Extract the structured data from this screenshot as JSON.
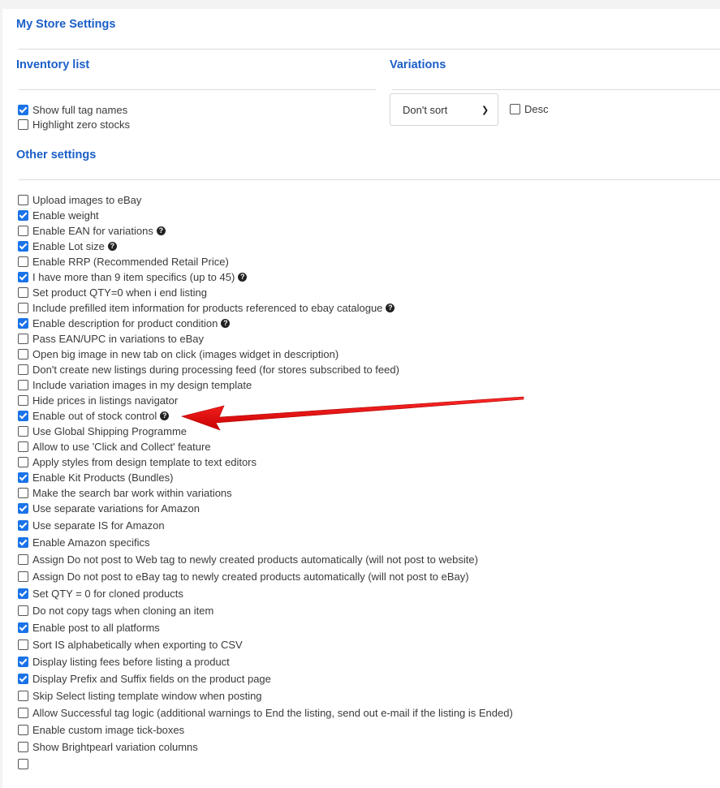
{
  "page_title": "My Store Settings",
  "inventory_list": {
    "title": "Inventory list",
    "options": [
      {
        "label": "Show full tag names",
        "checked": true
      },
      {
        "label": "Highlight zero stocks",
        "checked": false
      }
    ]
  },
  "variations": {
    "title": "Variations",
    "sort_select": {
      "value": "Don't sort"
    },
    "desc": {
      "label": "Desc",
      "checked": false
    }
  },
  "other_settings": {
    "title": "Other settings",
    "options": [
      {
        "label": "Upload images to eBay",
        "checked": false,
        "help": false
      },
      {
        "label": "Enable weight",
        "checked": true,
        "help": false
      },
      {
        "label": "Enable EAN for variations",
        "checked": false,
        "help": true
      },
      {
        "label": "Enable Lot size",
        "checked": true,
        "help": true
      },
      {
        "label": "Enable RRP (Recommended Retail Price)",
        "checked": false,
        "help": false
      },
      {
        "label": "I have more than 9 item specifics (up to 45)",
        "checked": true,
        "help": true
      },
      {
        "label": "Set product QTY=0 when i end listing",
        "checked": false,
        "help": false
      },
      {
        "label": "Include prefilled item information for products referenced to ebay catalogue",
        "checked": false,
        "help": true
      },
      {
        "label": "Enable description for product condition",
        "checked": true,
        "help": true
      },
      {
        "label": "Pass EAN/UPC in variations to eBay",
        "checked": false,
        "help": false
      },
      {
        "label": "Open big image in new tab on click (images widget in description)",
        "checked": false,
        "help": false
      },
      {
        "label": "Don't create new listings during processing feed (for stores subscribed to feed)",
        "checked": false,
        "help": false
      },
      {
        "label": "Include variation images in my design template",
        "checked": false,
        "help": false
      },
      {
        "label": "Hide prices in listings navigator",
        "checked": false,
        "help": false
      },
      {
        "label": "Enable out of stock control",
        "checked": true,
        "help": true
      },
      {
        "label": "Use Global Shipping Programme",
        "checked": false,
        "help": false
      },
      {
        "label": "Allow to use 'Click and Collect' feature",
        "checked": false,
        "help": false
      },
      {
        "label": "Apply styles from design template to text editors",
        "checked": false,
        "help": false
      },
      {
        "label": "Enable Kit Products (Bundles)",
        "checked": true,
        "help": false
      },
      {
        "label": "Make the search bar work within variations",
        "checked": false,
        "help": false
      },
      {
        "label": "Use separate variations for Amazon",
        "checked": true,
        "help": false
      },
      {
        "label": "Use separate IS for Amazon",
        "checked": true,
        "help": false
      },
      {
        "label": "Enable Amazon specifics",
        "checked": true,
        "help": false
      },
      {
        "label": "Assign Do not post to Web tag to newly created products automatically (will not post to website)",
        "checked": false,
        "help": false
      },
      {
        "label": "Assign Do not post to eBay tag to newly created products automatically (will not post to eBay)",
        "checked": false,
        "help": false
      },
      {
        "label": "Set QTY = 0 for cloned products",
        "checked": true,
        "help": false
      },
      {
        "label": "Do not copy tags when cloning an item",
        "checked": false,
        "help": false
      },
      {
        "label": "Enable post to all platforms",
        "checked": true,
        "help": false
      },
      {
        "label": "Sort IS alphabetically when exporting to CSV",
        "checked": false,
        "help": false
      },
      {
        "label": "Display listing fees before listing a product",
        "checked": true,
        "help": false
      },
      {
        "label": "Display Prefix and Suffix fields on the product page",
        "checked": true,
        "help": false
      },
      {
        "label": "Skip Select listing template window when posting",
        "checked": false,
        "help": false
      },
      {
        "label": "Allow Successful tag logic (additional warnings to End the listing, send out e-mail if the listing is Ended)",
        "checked": false,
        "help": false
      },
      {
        "label": "Enable custom image tick-boxes",
        "checked": false,
        "help": false
      },
      {
        "label": "Show Brightpearl variation columns",
        "checked": false,
        "help": false
      },
      {
        "label": "",
        "checked": false,
        "help": false
      }
    ]
  },
  "annotation": {
    "type": "red-arrow",
    "target": "Enable out of stock control",
    "color": "#e00000"
  },
  "help_glyph": "?"
}
